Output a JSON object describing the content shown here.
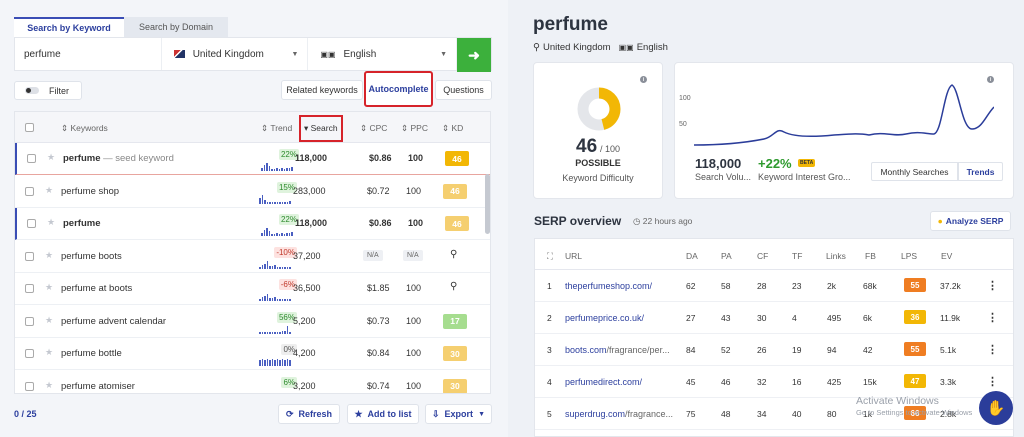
{
  "search": {
    "tab_keyword": "Search by Keyword",
    "tab_domain": "Search by Domain",
    "query": "perfume",
    "country": "United Kingdom",
    "language": "English"
  },
  "toolbar": {
    "filter": "Filter",
    "related": "Related keywords",
    "autocomplete": "Autocomplete",
    "questions": "Questions"
  },
  "table": {
    "headers": {
      "keywords": "Keywords",
      "trend": "Trend",
      "search": "Search",
      "cpc": "CPC",
      "ppc": "PPC",
      "kd": "KD"
    },
    "rows": [
      {
        "keyword": "perfume",
        "suffix": " — seed keyword",
        "bold": true,
        "trend": "22%",
        "dir": "up",
        "search": "118,000",
        "cpc": "$0.86",
        "ppc": "100",
        "kd": "46",
        "kd_color": "#f2b705"
      },
      {
        "keyword": "perfume shop",
        "suffix": "",
        "bold": false,
        "trend": "15%",
        "dir": "up",
        "search": "283,000",
        "cpc": "$0.72",
        "ppc": "100",
        "kd": "46",
        "kd_color": "#f5cf70"
      },
      {
        "keyword": "perfume",
        "suffix": "",
        "bold": true,
        "trend": "22%",
        "dir": "up",
        "search": "118,000",
        "cpc": "$0.86",
        "ppc": "100",
        "kd": "46",
        "kd_color": "#f5cf70"
      },
      {
        "keyword": "perfume boots",
        "suffix": "",
        "bold": false,
        "trend": "-10%",
        "dir": "down",
        "search": "37,200",
        "cpc": "N/A",
        "ppc": "N/A",
        "kd": "",
        "kd_color": ""
      },
      {
        "keyword": "perfume at boots",
        "suffix": "",
        "bold": false,
        "trend": "-6%",
        "dir": "down",
        "search": "36,500",
        "cpc": "$1.85",
        "ppc": "100",
        "kd": "",
        "kd_color": ""
      },
      {
        "keyword": "perfume advent calendar",
        "suffix": "",
        "bold": false,
        "trend": "56%",
        "dir": "up",
        "search": "5,200",
        "cpc": "$0.73",
        "ppc": "100",
        "kd": "17",
        "kd_color": "#a6dd8f"
      },
      {
        "keyword": "perfume bottle",
        "suffix": "",
        "bold": false,
        "trend": "0%",
        "dir": "flat",
        "search": "4,200",
        "cpc": "$0.84",
        "ppc": "100",
        "kd": "30",
        "kd_color": "#f5cf70"
      },
      {
        "keyword": "perfume atomiser",
        "suffix": "",
        "bold": false,
        "trend": "6%",
        "dir": "up",
        "search": "3,200",
        "cpc": "$0.74",
        "ppc": "100",
        "kd": "30",
        "kd_color": "#f5cf70"
      }
    ]
  },
  "footer": {
    "count": "0 / 25",
    "refresh": "Refresh",
    "add": "Add to list",
    "export": "Export"
  },
  "overview": {
    "title": "perfume",
    "country": "United Kingdom",
    "language": "English",
    "kd_value": "46",
    "kd_max": "/ 100",
    "kd_label": "POSSIBLE",
    "kd_caption": "Keyword Difficulty",
    "kd_fraction": 0.46,
    "volume": "118,000",
    "volume_label": "Search Volu...",
    "interest": "+22%",
    "beta": "BETA",
    "interest_label": "Keyword Interest Gro...",
    "toggle_monthly": "Monthly Searches",
    "toggle_trends": "Trends",
    "y_ticks": [
      "100",
      "50"
    ]
  },
  "serp": {
    "title": "SERP overview",
    "time": "22 hours ago",
    "analyze": "Analyze SERP",
    "headers": {
      "url": "URL",
      "da": "DA",
      "pa": "PA",
      "cf": "CF",
      "tf": "TF",
      "links": "Links",
      "fb": "FB",
      "lps": "LPS",
      "ev": "EV"
    },
    "rows": [
      {
        "n": "1",
        "domain": "theperfumeshop.com/",
        "path": "",
        "da": "62",
        "pa": "58",
        "cf": "28",
        "tf": "23",
        "links": "2k",
        "fb": "68k",
        "lps": "55",
        "lps_color": "#ef7d22",
        "ev": "37.2k"
      },
      {
        "n": "2",
        "domain": "perfumeprice.co.uk/",
        "path": "",
        "da": "27",
        "pa": "43",
        "cf": "30",
        "tf": "4",
        "links": "495",
        "fb": "6k",
        "lps": "36",
        "lps_color": "#f2b705",
        "ev": "11.9k"
      },
      {
        "n": "3",
        "domain": "boots.com",
        "path": "/fragrance/per...",
        "da": "84",
        "pa": "52",
        "cf": "26",
        "tf": "19",
        "links": "94",
        "fb": "42",
        "lps": "55",
        "lps_color": "#ef7d22",
        "ev": "5.1k"
      },
      {
        "n": "4",
        "domain": "perfumedirect.com/",
        "path": "",
        "da": "45",
        "pa": "46",
        "cf": "32",
        "tf": "16",
        "links": "425",
        "fb": "15k",
        "lps": "47",
        "lps_color": "#f2b705",
        "ev": "3.3k"
      },
      {
        "n": "5",
        "domain": "superdrug.com",
        "path": "/fragrance...",
        "da": "75",
        "pa": "48",
        "cf": "34",
        "tf": "40",
        "links": "80",
        "fb": "1k",
        "lps": "66",
        "lps_color": "#ef7d22",
        "ev": "2.8k"
      }
    ]
  },
  "watermark": {
    "line1": "Activate Windows",
    "line2": "Go to Settings to activate Windows."
  }
}
